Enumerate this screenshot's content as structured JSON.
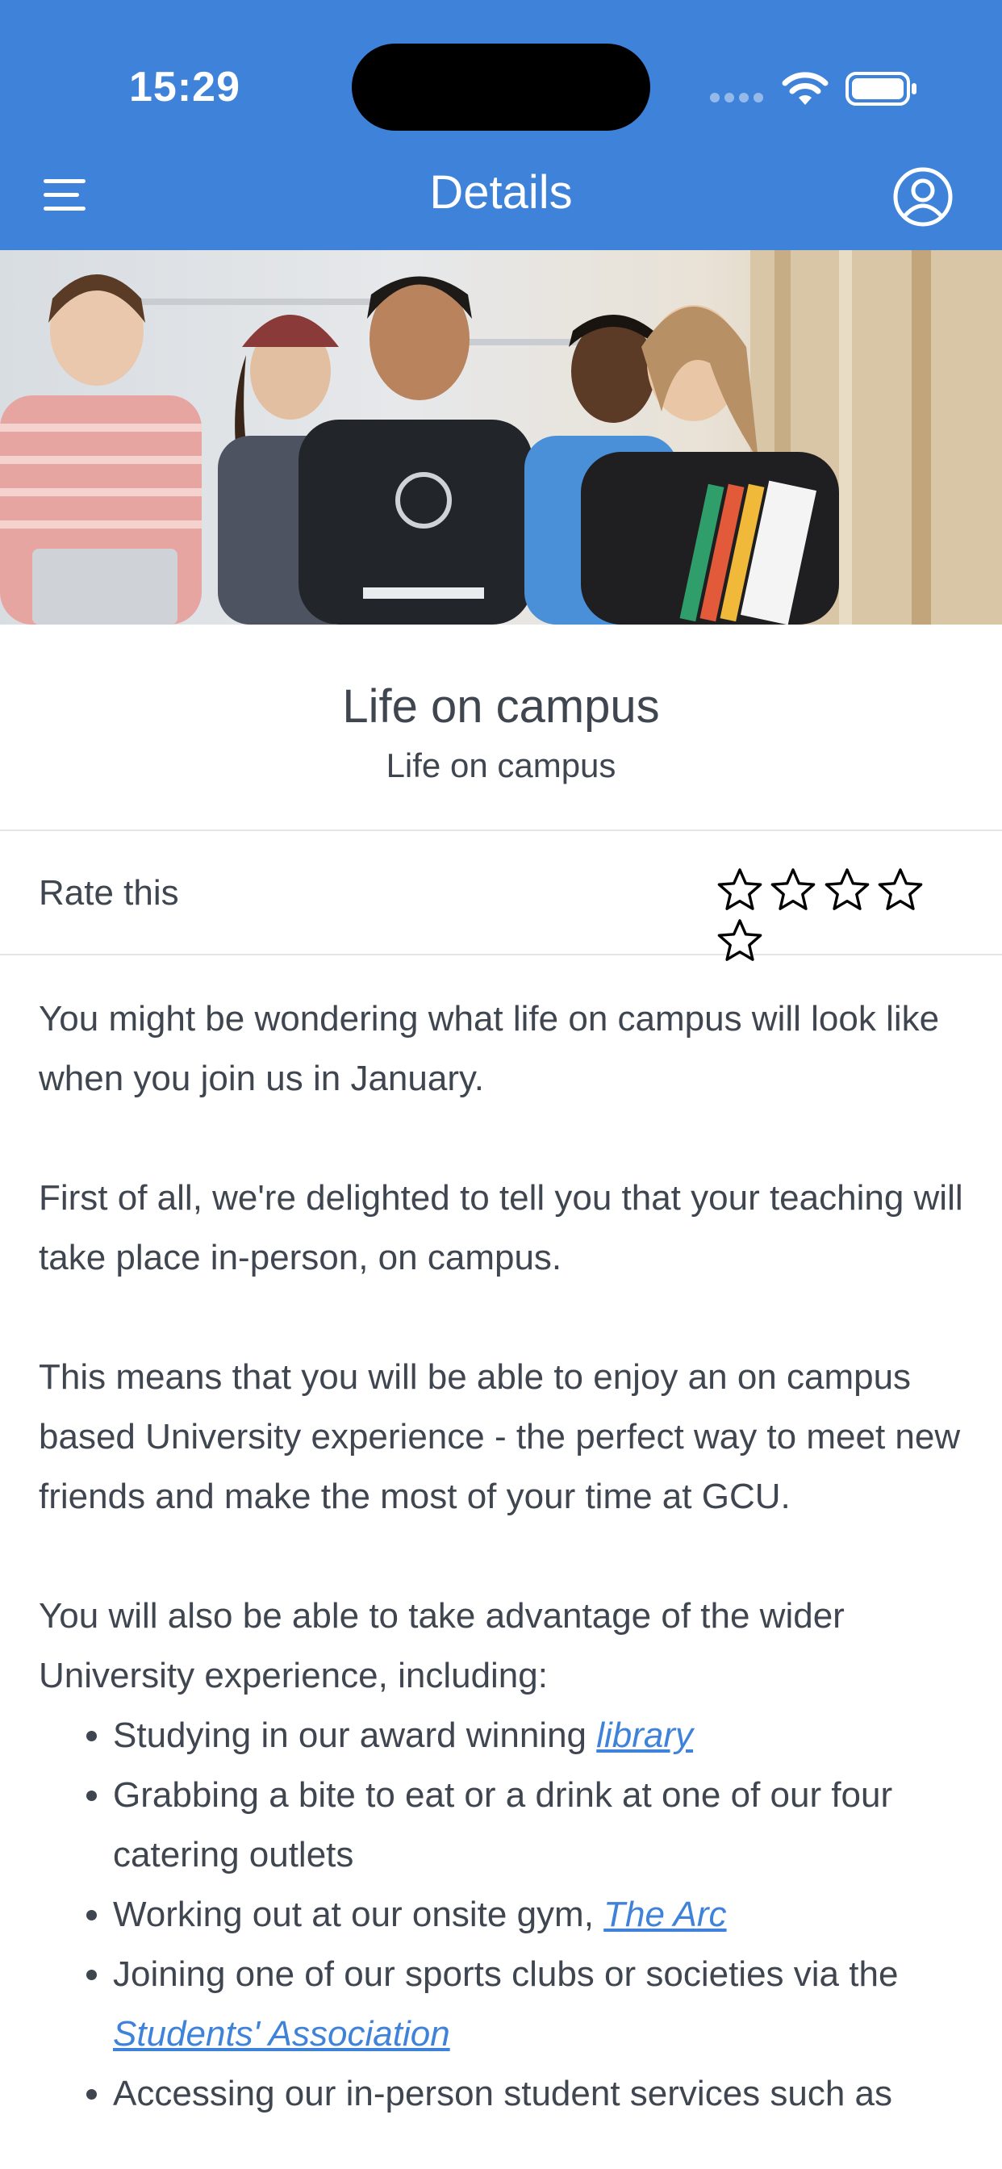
{
  "status_bar": {
    "time": "15:29"
  },
  "header": {
    "title": "Details",
    "menu_icon": "menu-icon",
    "profile_icon": "account-circle-icon",
    "background_color": "#3f82d9"
  },
  "article": {
    "title": "Life on campus",
    "subtitle": "Life on campus"
  },
  "rating": {
    "label": "Rate this",
    "max_stars": 5,
    "current": 0
  },
  "body": {
    "p1": "You might be wondering what life on campus will look like when you join us in January.",
    "p2": "First of all, we're delighted to tell you that your teaching will take place in-person, on campus.",
    "p3": "This means that you will be able to enjoy an on campus based University experience - the perfect way to meet new friends and make the most of your time at GCU.",
    "p4": "You will also be able to take advantage of the wider University experience, including:",
    "bullets": [
      {
        "text": "Studying in our award winning ",
        "link": "library"
      },
      {
        "text": "Grabbing a bite to eat or a drink at one of our four catering outlets",
        "link": ""
      },
      {
        "text": "Working out at our onsite gym, ",
        "link": "The Arc"
      },
      {
        "text": "Joining one of our sports clubs or societies via the ",
        "link": "Students' Association"
      },
      {
        "text": "Accessing our in-person student services such as",
        "link": ""
      }
    ],
    "link_color": "#3f82d9"
  }
}
